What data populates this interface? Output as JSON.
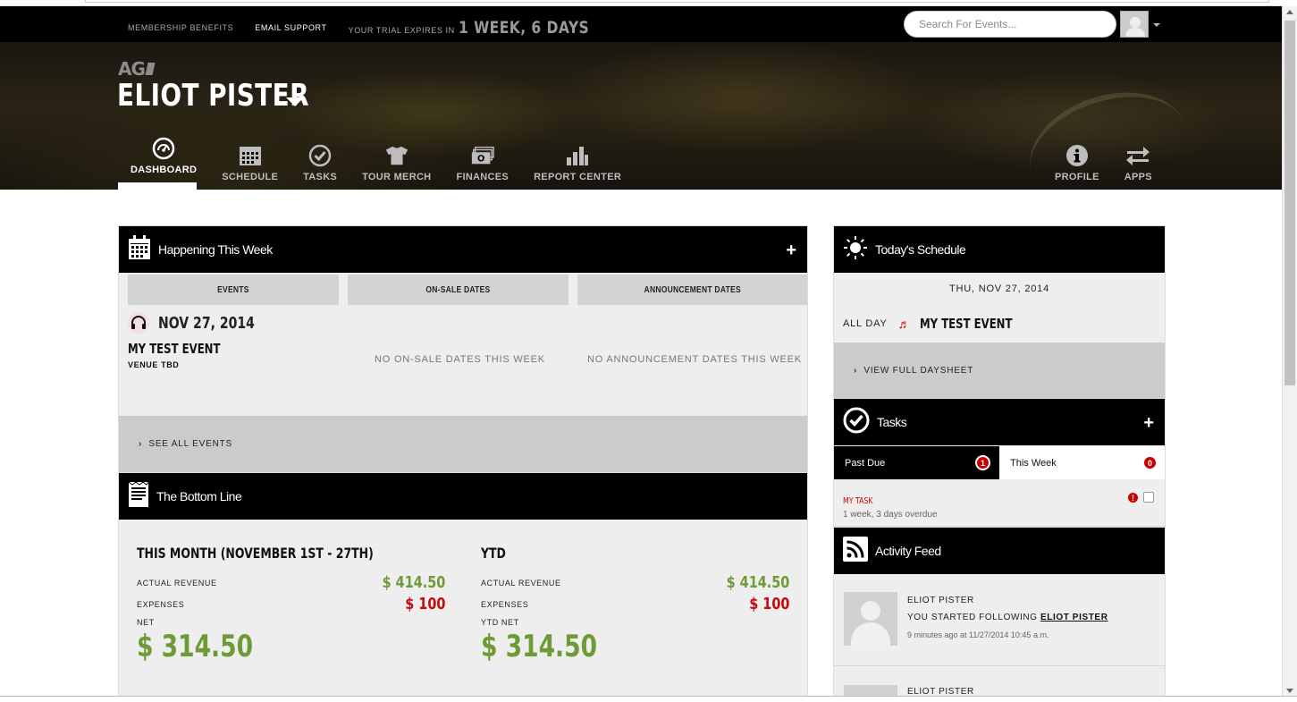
{
  "topnav": {
    "membership": "Membership Benefits",
    "email_support": "Email Support",
    "trial_label": "Your Trial Expires In",
    "trial_value": "1 WEEK, 6 DAYS"
  },
  "search": {
    "placeholder": "Search For Events..."
  },
  "logo": "AG",
  "artist": "ELIOT PISTER",
  "mainnav": [
    {
      "label": "DASHBOARD",
      "icon": "dashboard-gauge-icon"
    },
    {
      "label": "SCHEDULE",
      "icon": "calendar-icon"
    },
    {
      "label": "TASKS",
      "icon": "check-circle-icon"
    },
    {
      "label": "TOUR MERCH",
      "icon": "tshirt-icon"
    },
    {
      "label": "FINANCES",
      "icon": "cash-icon"
    },
    {
      "label": "REPORT CENTER",
      "icon": "bar-chart-icon"
    }
  ],
  "rightnav": [
    {
      "label": "PROFILE",
      "icon": "info-icon"
    },
    {
      "label": "APPS",
      "icon": "swap-arrows-icon"
    }
  ],
  "happening": {
    "title": "Happening This Week",
    "tabs": [
      "EVENTS",
      "ON-SALE DATES",
      "ANNOUNCEMENT DATES"
    ],
    "event_date": "NOV 27, 2014",
    "event_name": "MY TEST EVENT",
    "venue": "VENUE TBD",
    "no_onsale": "NO ON-SALE DATES THIS WEEK",
    "no_announce": "NO ANNOUNCEMENT DATES THIS WEEK",
    "see_all": "SEE ALL EVENTS"
  },
  "bottomline": {
    "title": "The Bottom Line",
    "month_title": "THIS MONTH (NOVEMBER 1ST - 27TH)",
    "ytd_title": "YTD",
    "actual_revenue_label": "ACTUAL REVENUE",
    "expenses_label": "EXPENSES",
    "net_label": "NET",
    "ytd_net_label": "YTD NET",
    "month_revenue": "$ 414.50",
    "month_expenses": "$ 100",
    "month_net": "$ 314.50",
    "ytd_revenue": "$ 414.50",
    "ytd_expenses": "$ 100",
    "ytd_net": "$ 314.50"
  },
  "today": {
    "title": "Today's Schedule",
    "date": "THU, NOV 27, 2014",
    "all_day": "ALL DAY",
    "event": "MY TEST EVENT",
    "daysheet": "VIEW FULL DAYSHEET"
  },
  "tasks": {
    "title": "Tasks",
    "past_due": "Past Due",
    "past_due_count": "1",
    "this_week": "This Week",
    "this_week_count": "0",
    "task_name": "MY TASK",
    "task_sub": "1 week, 3 days overdue"
  },
  "activity": {
    "title": "Activity Feed",
    "name": "ELIOT PISTER",
    "action": "YOU STARTED FOLLOWING",
    "target": "ELIOT PISTER",
    "time": "9 minutes ago at 11/27/2014 10:45 a.m.",
    "name2": "ELIOT PISTER"
  }
}
